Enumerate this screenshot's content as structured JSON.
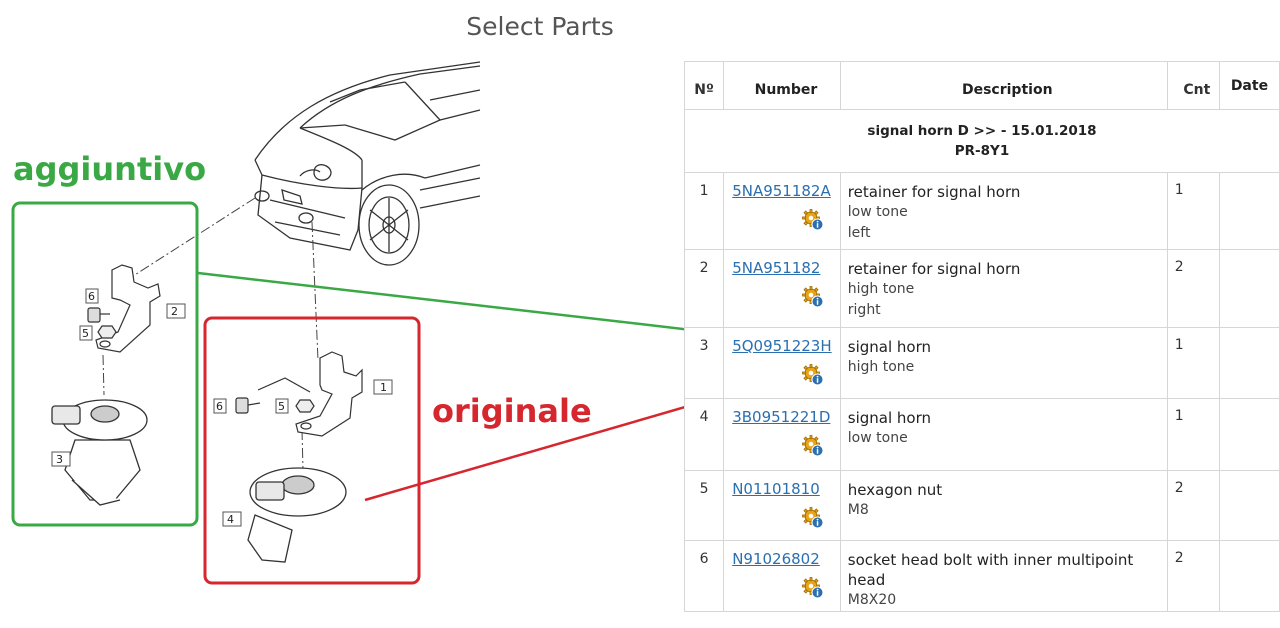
{
  "page": {
    "title": "Select Parts"
  },
  "labels": {
    "extra": "aggiuntivo",
    "original": "originale"
  },
  "colors": {
    "green": "#3aa844",
    "red": "#d6262e",
    "link": "#2a6fb0"
  },
  "diagram": {
    "callouts": [
      {
        "id": "6a",
        "text": "6"
      },
      {
        "id": "2",
        "text": "2"
      },
      {
        "id": "5a",
        "text": "5"
      },
      {
        "id": "3",
        "text": "3"
      },
      {
        "id": "6b",
        "text": "6"
      },
      {
        "id": "5b",
        "text": "5"
      },
      {
        "id": "1",
        "text": "1"
      },
      {
        "id": "4",
        "text": "4"
      }
    ]
  },
  "table": {
    "headers": {
      "no": "Nº",
      "number": "Number",
      "description": "Description",
      "cnt": "Cnt",
      "date": "Date"
    },
    "group": {
      "line1": "signal horn D >> - 15.01.2018",
      "line2": "PR-8Y1"
    },
    "info_icon": "gear-info-icon",
    "rows": [
      {
        "no": "1",
        "number": "5NA951182A",
        "desc": "retainer for signal horn",
        "sub": [
          "low tone",
          "left"
        ],
        "cnt": "1"
      },
      {
        "no": "2",
        "number": "5NA951182",
        "desc": "retainer for signal horn",
        "sub": [
          "high tone",
          "right"
        ],
        "cnt": "2"
      },
      {
        "no": "3",
        "number": "5Q0951223H",
        "desc": "signal horn",
        "sub": [
          "high tone"
        ],
        "cnt": "1"
      },
      {
        "no": "4",
        "number": "3B0951221D",
        "desc": "signal horn",
        "sub": [
          "low tone"
        ],
        "cnt": "1"
      },
      {
        "no": "5",
        "number": "N01101810",
        "desc": "hexagon nut",
        "sub": [
          "M8"
        ],
        "cnt": "2"
      },
      {
        "no": "6",
        "number": "N91026802",
        "desc": "socket head bolt with inner multipoint head",
        "sub": [
          "M8X20"
        ],
        "cnt": "2"
      }
    ]
  }
}
